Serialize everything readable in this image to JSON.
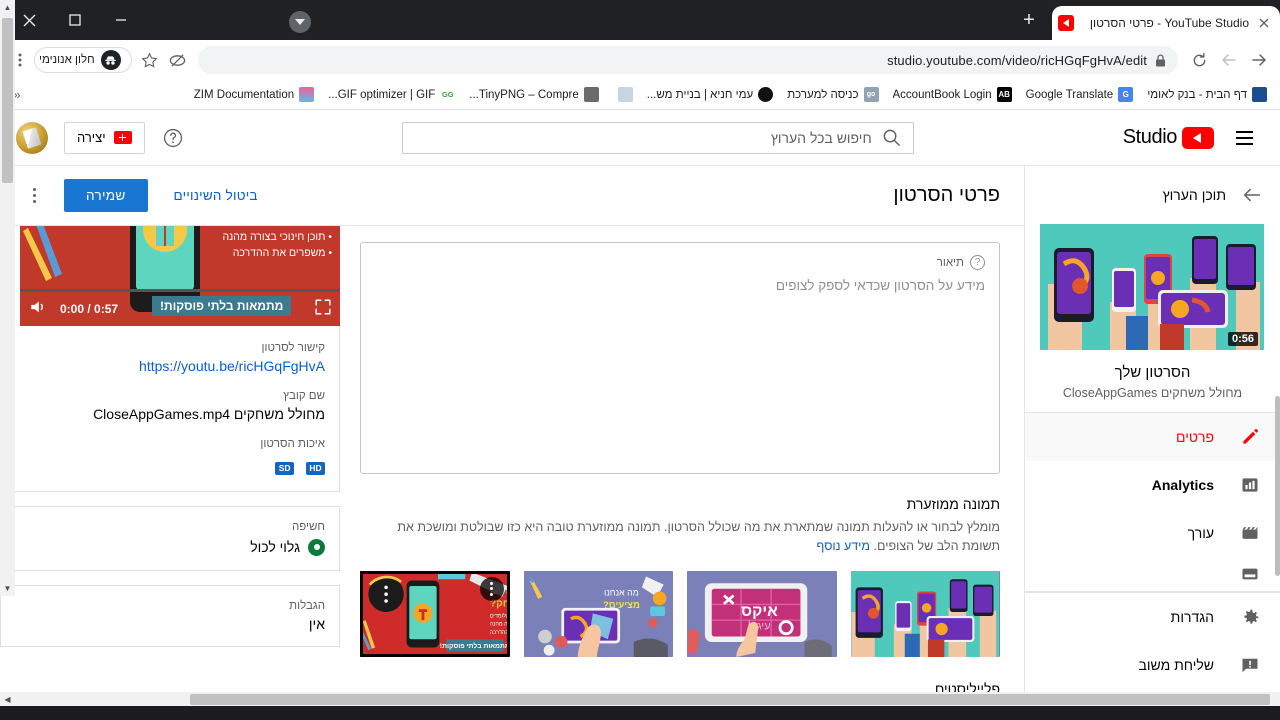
{
  "window": {
    "controls": {
      "close": "close-icon",
      "maximize": "maximize-icon",
      "minimize": "minimize-icon"
    }
  },
  "browser": {
    "tab": {
      "title": "YouTube Studio - פרטי הסרטון",
      "favicon": "youtube-icon",
      "close": "×"
    },
    "newtab_label": "+",
    "omnibox": {
      "url_prefix": "studio.youtube.com",
      "url_path": "/video/ricHGqFgHvA/edit",
      "full_url": "studio.youtube.com/video/ricHGqFgHvA/edit",
      "lock": "lock-icon"
    },
    "incognito_label": "חלון אנונימי",
    "nav": {
      "forward": "→",
      "back": "←",
      "reload": "↺"
    },
    "bookmarks": [
      {
        "label": "דף הבית - בנק לאומי",
        "icon_text": "",
        "icon_color": "#1a4f8b"
      },
      {
        "label": "Google Translate",
        "icon_text": "G",
        "icon_color": "#4285f4"
      },
      {
        "label": "AccountBook Login",
        "icon_text": "AB",
        "icon_color": "#000000"
      },
      {
        "label": "כניסה למערכת",
        "icon_text": "go",
        "icon_color": "#7a8b99"
      },
      {
        "label": "עמי חניא | בניית מש...",
        "icon_text": "",
        "icon_color": "#111111"
      },
      {
        "label": "",
        "icon_text": "",
        "icon_color": "#c7d4e2"
      },
      {
        "label": "TinyPNG – Compre...",
        "icon_text": "",
        "icon_color": "#6b6b6b"
      },
      {
        "label": "GIF optimizer | GIF...",
        "icon_text": "GG",
        "icon_color": "#ffffff"
      },
      {
        "label": "ZIM Documentation",
        "icon_text": "",
        "icon_color": "#f06292"
      }
    ],
    "overflow_chevron": "«"
  },
  "studio": {
    "brand": "Studio",
    "menu_icon": "hamburger-icon",
    "search_placeholder": "חיפוש בכל הערוץ",
    "search_icon": "search-icon",
    "help_icon": "help-icon",
    "create_label": "יצירה",
    "create_icon": "video-camera-plus-icon",
    "avatar": "channel-avatar"
  },
  "sidebar": {
    "title": "תוכן הערוץ",
    "back_icon": "arrow-back-icon",
    "video": {
      "duration": "0:56",
      "title": "הסרטון שלך",
      "channel": "מחולל משחקים CloseAppGames"
    },
    "items": [
      {
        "label": "פרטים",
        "icon": "pencil-icon",
        "active": true
      },
      {
        "label": "Analytics",
        "icon": "bar-chart-icon",
        "active": false
      },
      {
        "label": "עורך",
        "icon": "clapperboard-icon",
        "active": false
      },
      {
        "label": "",
        "icon": "subtitles-icon",
        "active": false
      }
    ],
    "footer_items": [
      {
        "label": "הגדרות",
        "icon": "gear-icon"
      },
      {
        "label": "שליחת משוב",
        "icon": "feedback-icon"
      }
    ]
  },
  "main": {
    "page_title": "פרטי הסרטון",
    "cancel_label": "ביטול השינויים",
    "save_label": "שמירה",
    "kebab_icon": "more-options-icon",
    "description": {
      "label": "תיאור",
      "help_icon": "help-circle-icon",
      "placeholder": "מידע על הסרטון שכדאי לספק לצופים",
      "value": ""
    },
    "thumbnail": {
      "title": "תמונה ממוזערת",
      "desc": "מומלץ לבחור או להעלות תמונה שמתארת את מה שכולל הסרטון. תמונה ממוזערת טובה היא כזו שבולטת ומושכת את תשומת הלב של הצופים.",
      "link": "מידע נוסף",
      "menu_icon": "more-options-icon",
      "options": [
        {
          "name": "thumbnail-option-1",
          "selected": false
        },
        {
          "name": "thumbnail-option-2",
          "selected": false
        },
        {
          "name": "thumbnail-option-3",
          "selected": false
        },
        {
          "name": "thumbnail-option-4",
          "selected": true
        }
      ]
    },
    "playlists_title": "פלייליסטים"
  },
  "preview": {
    "player": {
      "time": "0:00 / 0:57",
      "volume_icon": "volume-icon",
      "settings_icon": "gear-icon",
      "fullscreen_icon": "fullscreen-icon",
      "bullets": [
        "• תוכן חינוכי בצורה מהנה",
        "• משפרים את ההדרכה"
      ],
      "ribbon": "מתמאות בלתי פוסקות!"
    },
    "video_link_label": "קישור לסרטון",
    "video_link": "https://youtu.be/ricHGqFgHvA",
    "filename_label": "שם קובץ",
    "filename": "מחולל משחקים CloseAppGames.mp4",
    "quality_label": "איכות הסרטון",
    "quality_badges": [
      "HD",
      "SD"
    ],
    "visibility_label": "חשיפה",
    "visibility_value": "גלוי לכול",
    "visibility_icon": "eye-icon",
    "restrictions_label": "הגבלות",
    "restrictions_value": "אין"
  }
}
